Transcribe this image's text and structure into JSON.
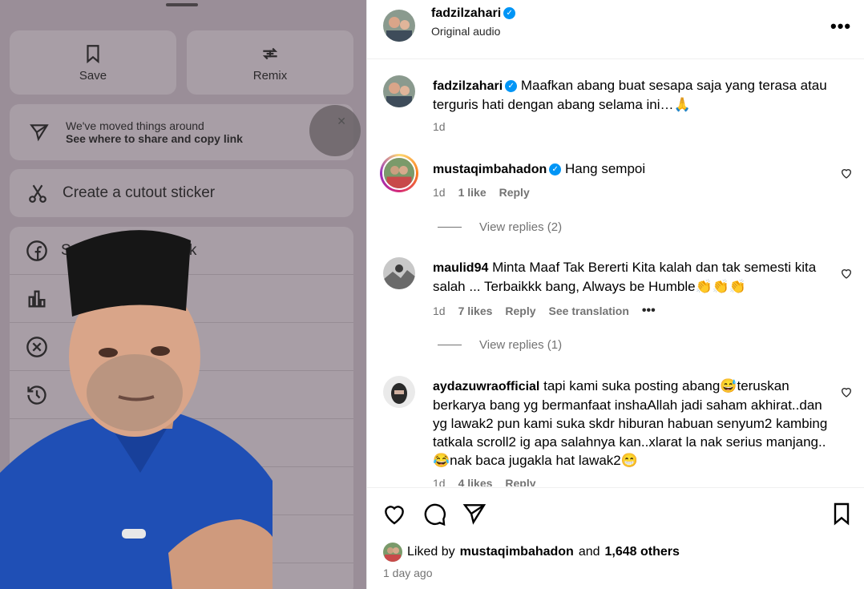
{
  "share_sheet": {
    "save_label": "Save",
    "remix_label": "Remix",
    "notice_line1": "We've moved things around",
    "notice_line2": "See where to share and copy link",
    "dismiss_glyph": "✕",
    "cutout_label": "Create a cutout sticker",
    "partial_row_label": "S",
    "partial_row_suffix": "ook"
  },
  "post": {
    "author": "fadzilzahari",
    "audio": "Original audio",
    "more_glyph": "•••",
    "caption": "Maafkan abang buat sesapa saja yang terasa atau terguris hati dengan abang selama ini…🙏",
    "caption_age": "1d"
  },
  "comments": [
    {
      "username": "mustaqimbahadon",
      "verified": true,
      "text": "Hang sempoi",
      "age": "1d",
      "likes": "1 like",
      "reply": "Reply",
      "view_replies": "View replies (2)"
    },
    {
      "username": "maulid94",
      "text": "Minta Maaf Tak Bererti Kita kalah dan tak semesti kita salah ... Terbaikkk bang, Always be Humble👏👏👏",
      "age": "1d",
      "likes": "7 likes",
      "reply": "Reply",
      "translate": "See translation",
      "more": "•••",
      "view_replies": "View replies (1)"
    },
    {
      "username": "aydazuwraofficial",
      "text": "tapi kami suka posting abang😅teruskan berkarya bang yg bermanfaat inshaAllah jadi saham akhirat..dan yg lawak2 pun kami suka skdr hiburan habuan senyum2 kambing tatkala scroll2 ig apa salahnya kan..xlarat la nak serius manjang..😂nak baca jugakla hat lawak2😁",
      "age": "1d",
      "likes": "4 likes",
      "reply": "Reply"
    }
  ],
  "footer": {
    "liked_prefix": "Liked by",
    "liked_user": "mustaqimbahadon",
    "liked_and": "and",
    "liked_count": "1,648 others",
    "time": "1 day ago"
  },
  "colors": {
    "verified": "#0095f6",
    "meta_gray": "#737373",
    "sheet_bg": "#a89ea6"
  }
}
